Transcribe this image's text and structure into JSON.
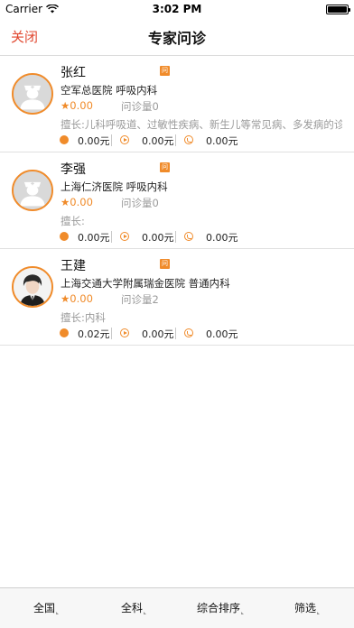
{
  "status": {
    "carrier": "Carrier",
    "time": "3:02 PM"
  },
  "nav": {
    "close": "关闭",
    "title": "专家问诊"
  },
  "tag_icon": "问",
  "doctors": [
    {
      "name": "张红",
      "hospital": "空军总医院 呼吸内科",
      "rating": "★0.00",
      "visits": "问诊量0",
      "specialty": "擅长:儿科呼吸道、过敏性疾病、新生儿等常见病、多发病的诊治",
      "prices": [
        "0.00元",
        "0.00元",
        "0.00元"
      ],
      "avatar": "default-doctor-avatar"
    },
    {
      "name": "李强",
      "hospital": "上海仁济医院 呼吸内科",
      "rating": "★0.00",
      "visits": "问诊量0",
      "specialty": "擅长:",
      "prices": [
        "0.00元",
        "0.00元",
        "0.00元"
      ],
      "avatar": "default-doctor-avatar"
    },
    {
      "name": "王建",
      "hospital": "上海交通大学附属瑞金医院 普通内科",
      "rating": "★0.00",
      "visits": "问诊量2",
      "specialty": "擅长:内科",
      "prices": [
        "0.02元",
        "0.00元",
        "0.00元"
      ],
      "avatar": "photo-avatar"
    }
  ],
  "tabs": {
    "region": "全国",
    "department": "全科",
    "sort": "综合排序",
    "filter": "筛选"
  },
  "colors": {
    "accent": "#f08b2a",
    "close": "#e0472f"
  }
}
